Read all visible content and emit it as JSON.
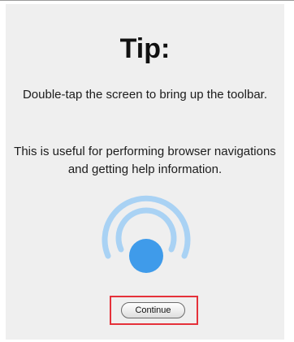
{
  "tip": {
    "title": "Tip:",
    "message_1": "Double-tap the screen to bring up the toolbar.",
    "message_2": "This is useful for performing browser navigations and getting help information."
  },
  "actions": {
    "continue_label": "Continue"
  },
  "icons": {
    "double_tap": "double-tap-gesture-icon"
  },
  "colors": {
    "panel_background": "#efefef",
    "icon_inner": "#3f9bea",
    "icon_rings": "#a9d2f4",
    "highlight_border": "#e5313a"
  }
}
